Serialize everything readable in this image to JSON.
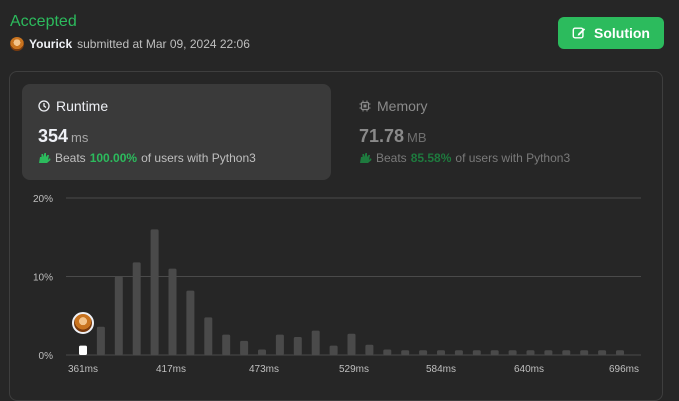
{
  "header": {
    "status": "Accepted",
    "user": "Yourick",
    "submitted_text": "submitted at Mar 09, 2024 22:06"
  },
  "solution_button": {
    "label": "Solution",
    "icon": "edit-icon"
  },
  "runtime": {
    "title": "Runtime",
    "icon": "clock-icon",
    "value": "354",
    "unit": "ms",
    "beats_label": "Beats",
    "beats_pct": "100.00%",
    "beats_suffix": "of users with Python3"
  },
  "memory": {
    "title": "Memory",
    "icon": "chip-icon",
    "value": "71.78",
    "unit": "MB",
    "beats_label": "Beats",
    "beats_pct": "85.58%",
    "beats_suffix": "of users with Python3"
  },
  "chart_data": {
    "type": "bar",
    "title": "",
    "xlabel": "",
    "ylabel": "",
    "ylim": [
      0,
      20
    ],
    "yticks": [
      "20%",
      "10%",
      "0%"
    ],
    "xtick_labels": [
      "361ms",
      "417ms",
      "473ms",
      "529ms",
      "584ms",
      "640ms",
      "696ms"
    ],
    "values": [
      1.2,
      3.6,
      10.0,
      11.8,
      16.0,
      11.0,
      8.2,
      4.8,
      2.6,
      1.8,
      0.7,
      2.6,
      2.3,
      3.1,
      1.2,
      2.7,
      1.3,
      0.7,
      0.6,
      0.6,
      0.6,
      0.6,
      0.6,
      0.6,
      0.6,
      0.6,
      0.6,
      0.6,
      0.6,
      0.6,
      0.6
    ],
    "highlight_index": 0,
    "colors": {
      "bar": "#4a4a4a",
      "highlight": "#ffffff",
      "grid": "#4a4a4a",
      "tick": "#bfbfbf"
    }
  }
}
